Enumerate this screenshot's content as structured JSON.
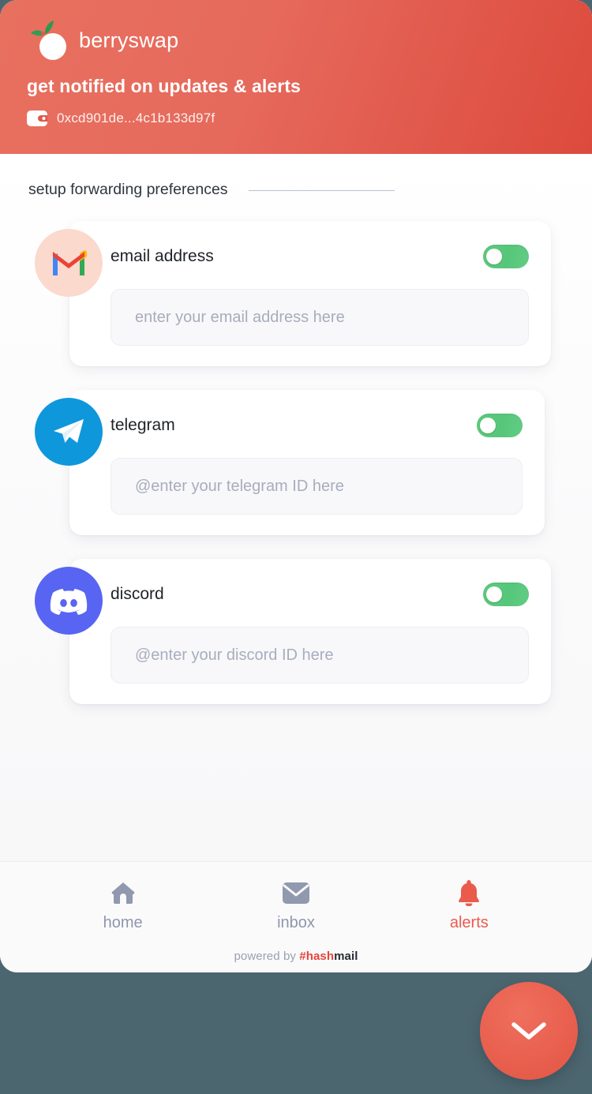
{
  "header": {
    "brand_name": "berryswap",
    "tagline": "get notified on updates & alerts",
    "wallet_address": "0xcd901de...4c1b133d97f",
    "logo_icon": "berry-logo-icon",
    "wallet_icon": "wallet-icon",
    "accent_color": "#e2584a"
  },
  "section": {
    "title": "setup forwarding preferences"
  },
  "channels": [
    {
      "id": "email",
      "label": "email address",
      "icon": "gmail-icon",
      "badge_color": "#fbd9cd",
      "placeholder": "enter your email address here",
      "value": "",
      "toggle_on": true,
      "toggle_color": "#5bc87c"
    },
    {
      "id": "telegram",
      "label": "telegram",
      "icon": "telegram-icon",
      "badge_color": "#0f97dc",
      "placeholder": "@enter your telegram ID here",
      "value": "",
      "toggle_on": true,
      "toggle_color": "#5bc87c"
    },
    {
      "id": "discord",
      "label": "discord",
      "icon": "discord-icon",
      "badge_color": "#5865f2",
      "placeholder": "@enter your discord ID here",
      "value": "",
      "toggle_on": true,
      "toggle_color": "#5bc87c"
    }
  ],
  "nav": {
    "items": [
      {
        "id": "home",
        "label": "home",
        "icon": "home-icon",
        "active": false,
        "color": "#8e96ab"
      },
      {
        "id": "inbox",
        "label": "inbox",
        "icon": "envelope-icon",
        "active": false,
        "color": "#8e96ab"
      },
      {
        "id": "alerts",
        "label": "alerts",
        "icon": "bell-icon",
        "active": true,
        "color": "#ea5b4c"
      }
    ]
  },
  "footer": {
    "powered_prefix": "powered by ",
    "brand_hash": "#hash",
    "brand_mail": "mail"
  },
  "fab": {
    "icon": "chevron-down-icon",
    "color": "#e9604f"
  },
  "page": {
    "background_color": "#4c6670"
  }
}
